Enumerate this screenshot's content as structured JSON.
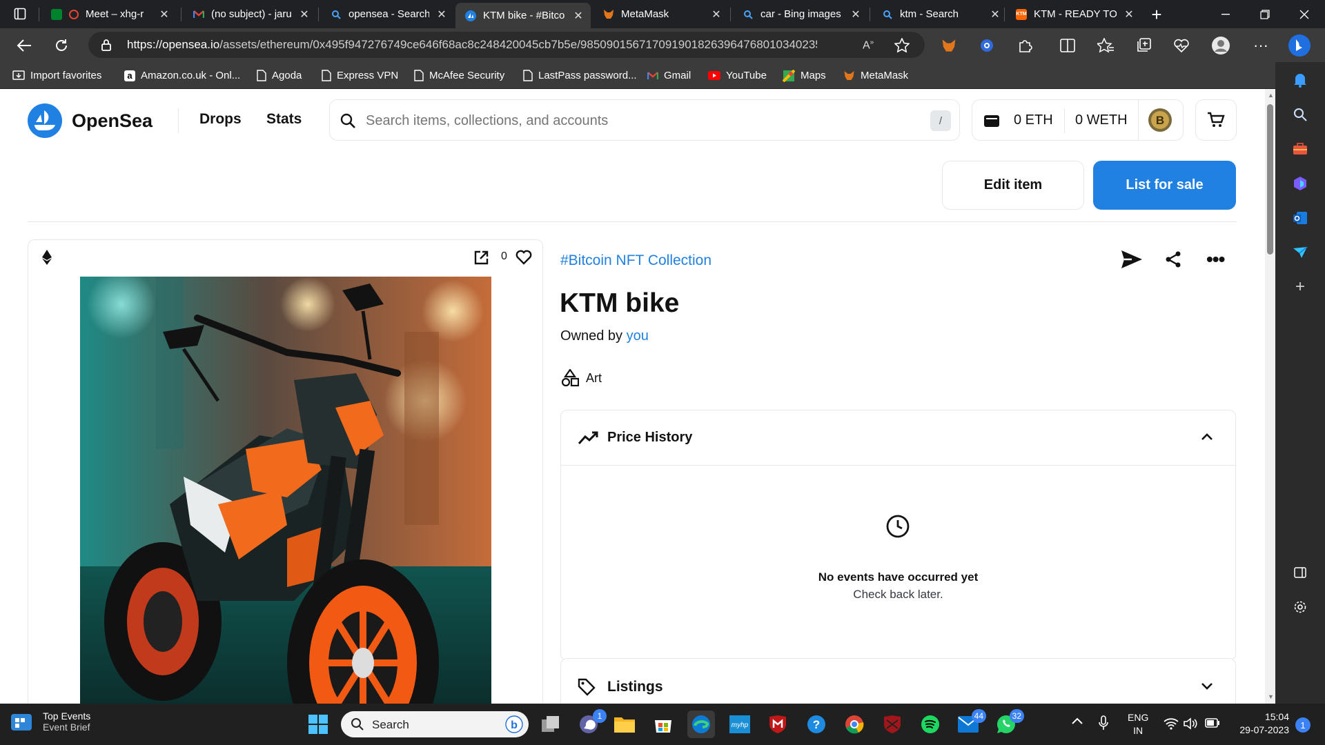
{
  "browser": {
    "tabs": [
      {
        "label": "Meet – xhg-r",
        "icon": "google-meet-icon"
      },
      {
        "label": "(no subject) - jaru",
        "icon": "gmail-icon"
      },
      {
        "label": "opensea - Search",
        "icon": "bing-search-icon"
      },
      {
        "label": "KTM bike - #Bitco",
        "icon": "opensea-icon",
        "active": true
      },
      {
        "label": "MetaMask",
        "icon": "metamask-fox-icon"
      },
      {
        "label": "car - Bing images",
        "icon": "bing-search-icon"
      },
      {
        "label": "ktm - Search",
        "icon": "bing-search-icon"
      },
      {
        "label": "KTM - READY TO",
        "icon": "ktm-icon"
      }
    ],
    "url_host": "https://opensea.io",
    "url_path": "/assets/ethereum/0x495f947276749ce646f68ac8c248420045cb7b5e/98509015671709190182639647680103402359...",
    "bookmarks": [
      "Import favorites",
      "Amazon.co.uk - Onl...",
      "Agoda",
      "Express VPN",
      "McAfee Security",
      "LastPass password...",
      "Gmail",
      "YouTube",
      "Maps",
      "MetaMask"
    ]
  },
  "opensea": {
    "logo_text": "OpenSea",
    "nav": {
      "drops": "Drops",
      "stats": "Stats"
    },
    "search": {
      "placeholder": "Search items, collections, and accounts",
      "shortcut": "/"
    },
    "wallet": {
      "eth": "0 ETH",
      "weth": "0 WETH"
    },
    "actions": {
      "edit": "Edit item",
      "list": "List for sale"
    },
    "asset": {
      "favorites": "0",
      "collection": "#Bitcoin NFT Collection",
      "title": "KTM bike",
      "owned_by": "Owned by",
      "owner": "you",
      "category": "Art"
    },
    "price_history": {
      "title": "Price History",
      "empty_title": "No events have occurred yet",
      "empty_sub": "Check back later."
    },
    "listings": {
      "title": "Listings"
    }
  },
  "taskbar": {
    "widget_title": "Top Events",
    "widget_sub": "Event Brief",
    "search": "Search",
    "badges": {
      "teams": "1",
      "mail": "44",
      "whatsapp": "32"
    },
    "lang": "ENG",
    "region": "IN",
    "time": "15:04",
    "date": "29-07-2023",
    "notifications": "1"
  },
  "colors": {
    "accent": "#2081e2",
    "chrome_dark": "#202124",
    "chrome_mid": "#3b3b3b",
    "taskbar": "#202020"
  }
}
